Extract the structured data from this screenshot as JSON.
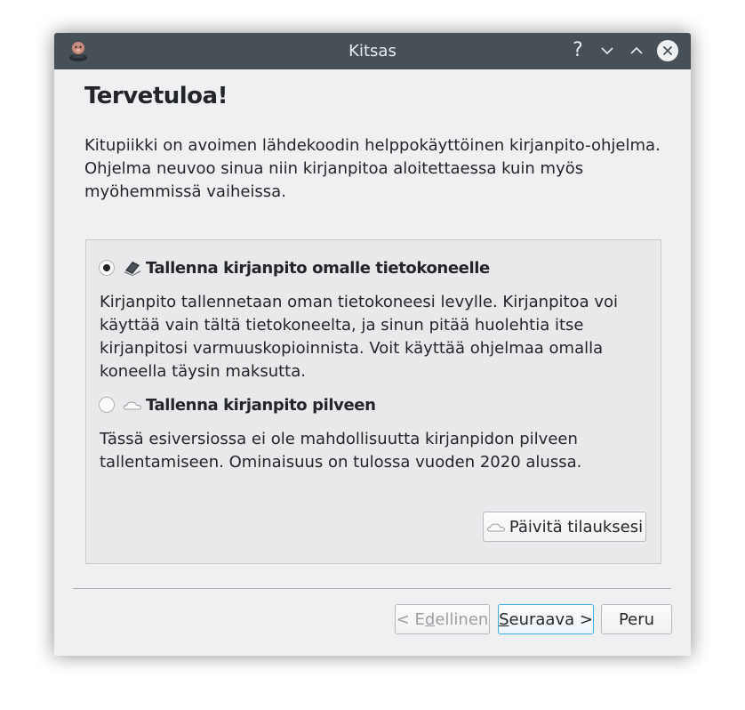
{
  "window": {
    "title": "Kitsas",
    "help_label": "?",
    "minimize_label": "⌄",
    "maximize_label": "⌃"
  },
  "page": {
    "heading": "Tervetuloa!",
    "intro": "Kitupiikki on avoimen lähdekoodin helppokäyttöinen kirjanpito-ohjelma. Ohjelma neuvoo sinua niin kirjanpitoa aloitettaessa kuin myös myöhemmissä vaiheissa."
  },
  "options": [
    {
      "label": "Tallenna kirjanpito omalle tietokoneelle",
      "description": "Kirjanpito tallennetaan oman tietokoneesi levylle. Kirjanpitoa voi käyttää vain tältä tietokoneelta, ja sinun pitää huolehtia itse kirjanpitosi varmuuskopioinnista. Voit käyttää ohjelmaa omalla koneella täysin maksutta.",
      "selected": true,
      "icon": "laptop-icon"
    },
    {
      "label": "Tallenna kirjanpito pilveen",
      "description": "Tässä esiversiossa ei ole mahdollisuutta kirjanpidon pilveen tallentamiseen. Ominaisuus on tulossa vuoden 2020 alussa.",
      "selected": false,
      "icon": "cloud-icon"
    }
  ],
  "update_button": {
    "label": "Päivitä tilauksesi",
    "icon": "cloud-icon"
  },
  "footer": {
    "prev_prefix": "< E",
    "prev_mnemonic": "d",
    "prev_suffix": "ellinen",
    "next_mnemonic": "S",
    "next_suffix": "euraava >",
    "cancel_label": "Peru"
  },
  "colors": {
    "titlebar": "#475057",
    "window_bg": "#eff0f1",
    "focus_accent": "#3daee9",
    "text": "#232629"
  }
}
